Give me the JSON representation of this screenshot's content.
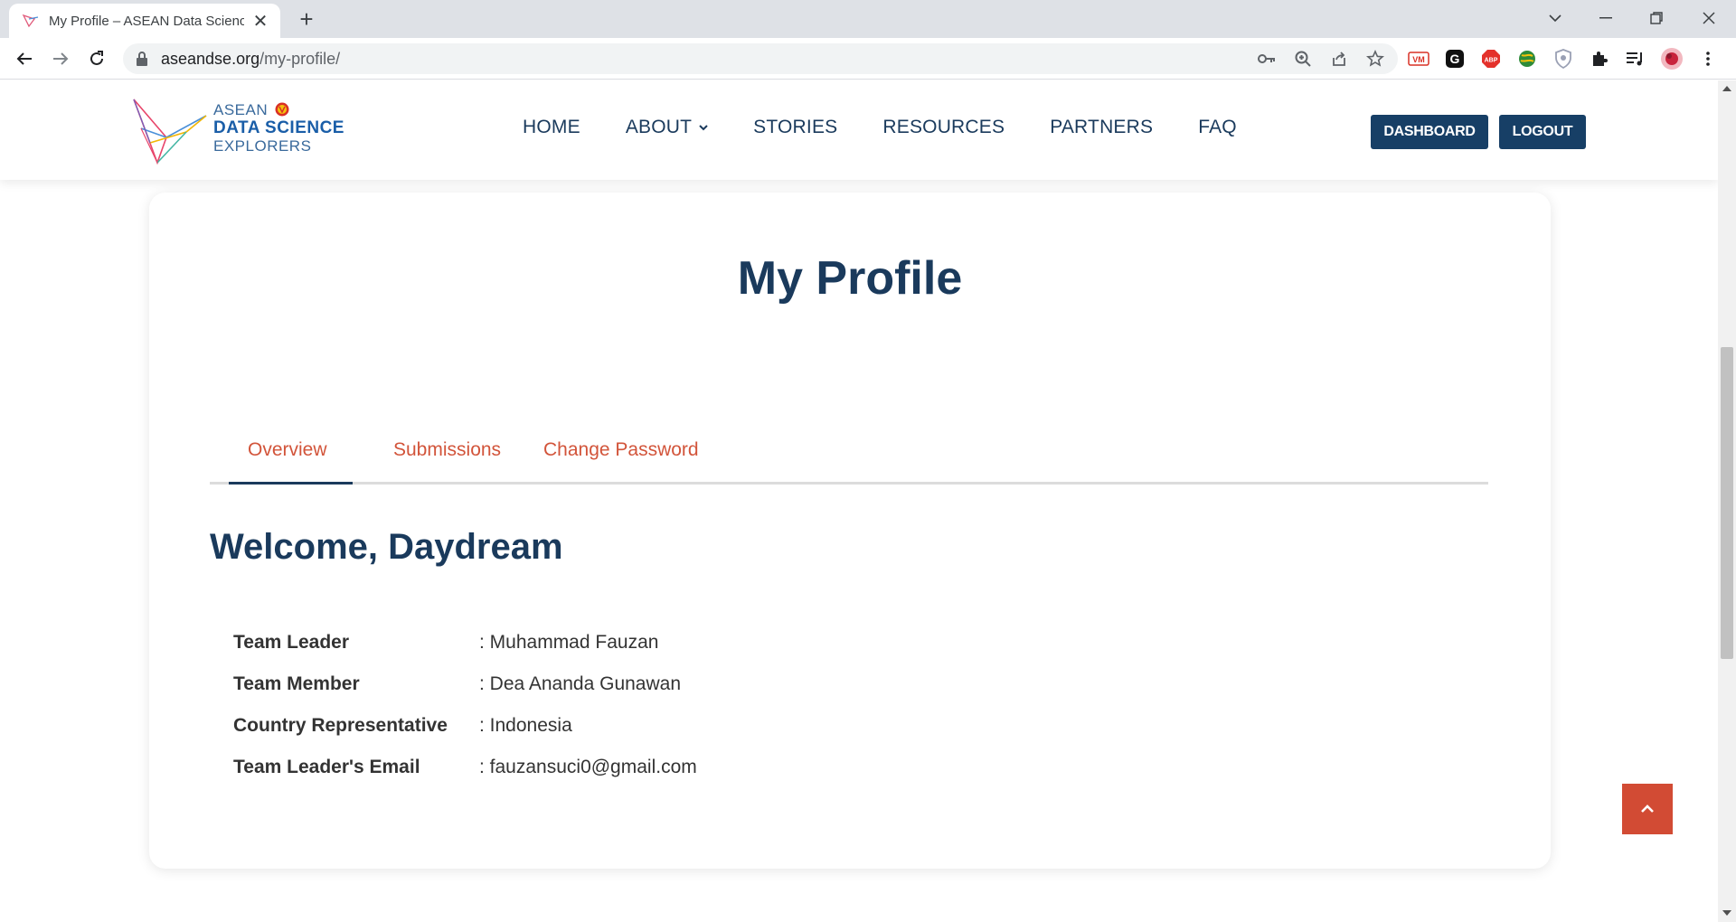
{
  "browser": {
    "tab_title": "My Profile – ASEAN Data Science Explorers",
    "url_host": "aseandse.org",
    "url_path": "/my-profile/"
  },
  "site": {
    "logo_line1": "ASEAN",
    "logo_line2": "DATA SCIENCE",
    "logo_line3": "EXPLORERS",
    "nav": {
      "home": "HOME",
      "about": "ABOUT",
      "stories": "STORIES",
      "resources": "RESOURCES",
      "partners": "PARTNERS",
      "faq": "FAQ"
    },
    "dashboard_label": "DASHBOARD",
    "logout_label": "LOGOUT"
  },
  "profile": {
    "title": "My Profile",
    "tabs": {
      "overview": "Overview",
      "submissions": "Submissions",
      "change_password": "Change Password"
    },
    "active_tab": "Overview",
    "welcome": "Welcome, Daydream",
    "rows": [
      {
        "label": "Team Leader",
        "value": ": Muhammad Fauzan"
      },
      {
        "label": "Team Member",
        "value": ": Dea Ananda Gunawan"
      },
      {
        "label": "Country Representative",
        "value": ": Indonesia"
      },
      {
        "label": "Team Leader's Email",
        "value": ": fauzansuci0@gmail.com"
      }
    ]
  },
  "colors": {
    "navy": "#1a3a5c",
    "button_navy": "#173f66",
    "accent_orange": "#d2543a",
    "back_to_top": "#d24b34"
  }
}
